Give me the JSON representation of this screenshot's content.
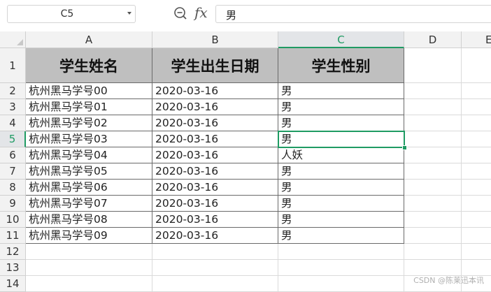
{
  "formula_bar": {
    "cell_ref": "C5",
    "formula_label": "fx",
    "value": "男"
  },
  "columns": [
    "A",
    "B",
    "C",
    "D",
    "E"
  ],
  "rows": [
    "1",
    "2",
    "3",
    "4",
    "5",
    "6",
    "7",
    "8",
    "9",
    "10",
    "11",
    "12",
    "13",
    "14"
  ],
  "header_cells": [
    "学生姓名",
    "学生出生日期",
    "学生性别"
  ],
  "data_rows": [
    {
      "name": "杭州黑马学号00",
      "date": "2020-03-16",
      "gender": "男"
    },
    {
      "name": "杭州黑马学号01",
      "date": "2020-03-16",
      "gender": "男"
    },
    {
      "name": "杭州黑马学号02",
      "date": "2020-03-16",
      "gender": "男"
    },
    {
      "name": "杭州黑马学号03",
      "date": "2020-03-16",
      "gender": "男"
    },
    {
      "name": "杭州黑马学号04",
      "date": "2020-03-16",
      "gender": "人妖"
    },
    {
      "name": "杭州黑马学号05",
      "date": "2020-03-16",
      "gender": "男"
    },
    {
      "name": "杭州黑马学号06",
      "date": "2020-03-16",
      "gender": "男"
    },
    {
      "name": "杭州黑马学号07",
      "date": "2020-03-16",
      "gender": "男"
    },
    {
      "name": "杭州黑马学号08",
      "date": "2020-03-16",
      "gender": "男"
    },
    {
      "name": "杭州黑马学号09",
      "date": "2020-03-16",
      "gender": "男"
    }
  ],
  "selected_cell": "C5",
  "accent_color": "#1f9b63",
  "header_fill": "#bfbfbf",
  "watermark": "CSDN @陈莱迅本讯"
}
